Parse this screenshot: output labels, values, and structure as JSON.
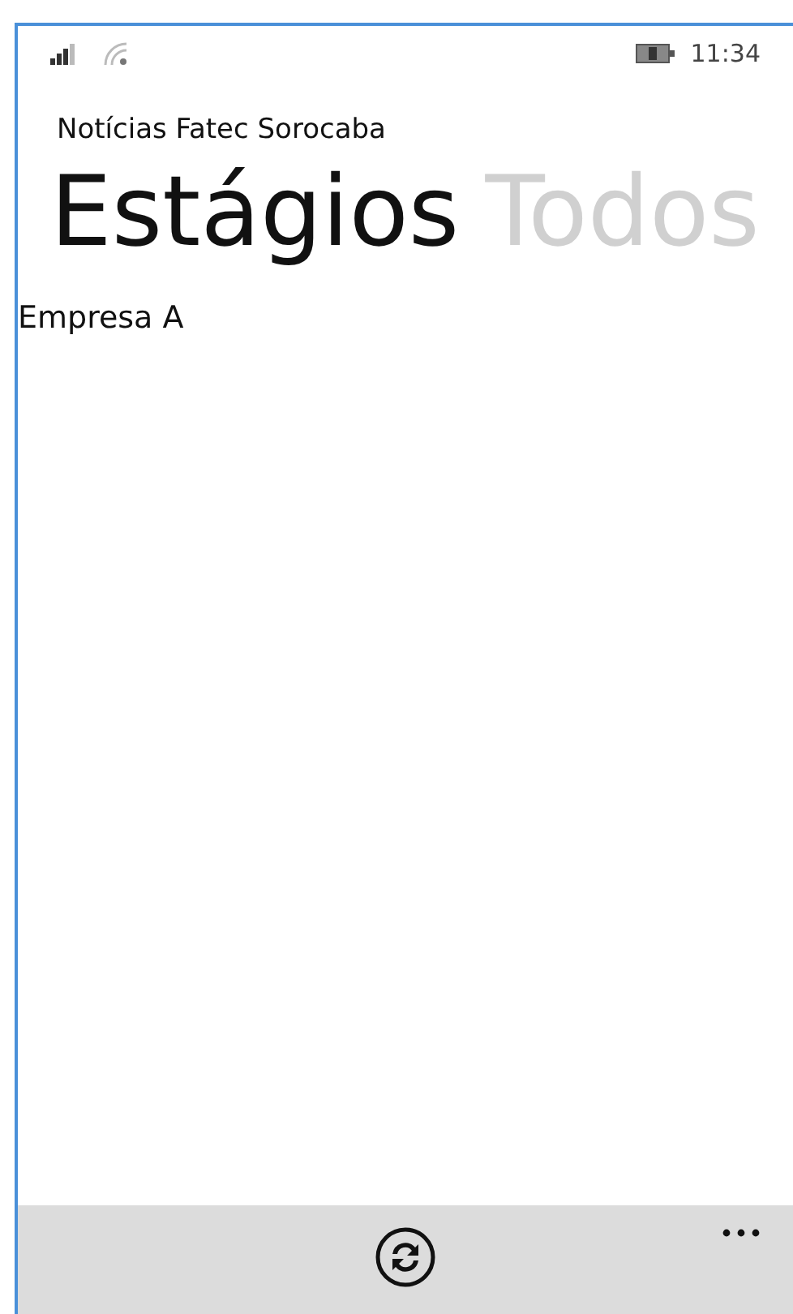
{
  "status_bar": {
    "time": "11:34"
  },
  "app_title": "Notícias Fatec Sorocaba",
  "pivot": [
    {
      "label": "Estágios",
      "selected": true
    },
    {
      "label": "Todos",
      "selected": false
    }
  ],
  "items": [
    "Empresa A"
  ]
}
